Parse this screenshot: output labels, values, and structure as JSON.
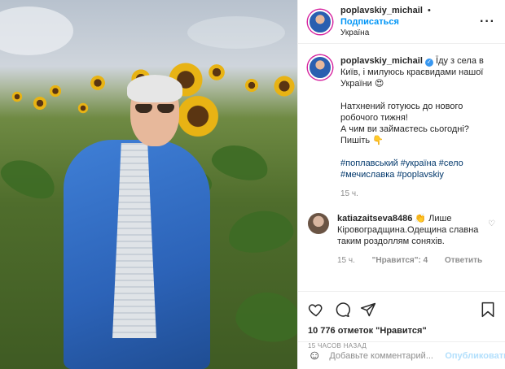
{
  "header": {
    "username": "poplavskiy_michail",
    "separator": "•",
    "follow_label": "Подписаться",
    "location": "Україна",
    "more_label": "···"
  },
  "caption": {
    "username": "poplavskiy_michail",
    "verified_mark": "✓",
    "line1": "Їду з села в Київ, і милуюсь краєвидами нашої України 😍",
    "line2": "Натхнений готуюсь до нового робочого тижня!",
    "line3": "А чим ви займаєтесь сьогодні? Пишіть 👇",
    "tags": "#поплавський #україна #село #мечиславка #poplavskiy",
    "time": "15 ч."
  },
  "reply": {
    "username": "katiazaitseva8486",
    "text": "👏 Лише Кіровоградщина.Одещина славна таким роздоллям соняхів.",
    "time": "15 ч.",
    "likes": "\"Нравится\": 4",
    "reply_label": "Ответить",
    "heart": "♡"
  },
  "actions": {
    "likes": "10 776 отметок \"Нравится\"",
    "timestamp": "15 часов назад"
  },
  "comment_box": {
    "emoji": "☺",
    "placeholder": "Добавьте комментарий...",
    "publish_label": "Опубликовать"
  },
  "colors": {
    "accent": "#0095f6",
    "verified": "#3897f0",
    "hashtag": "#00376b"
  }
}
